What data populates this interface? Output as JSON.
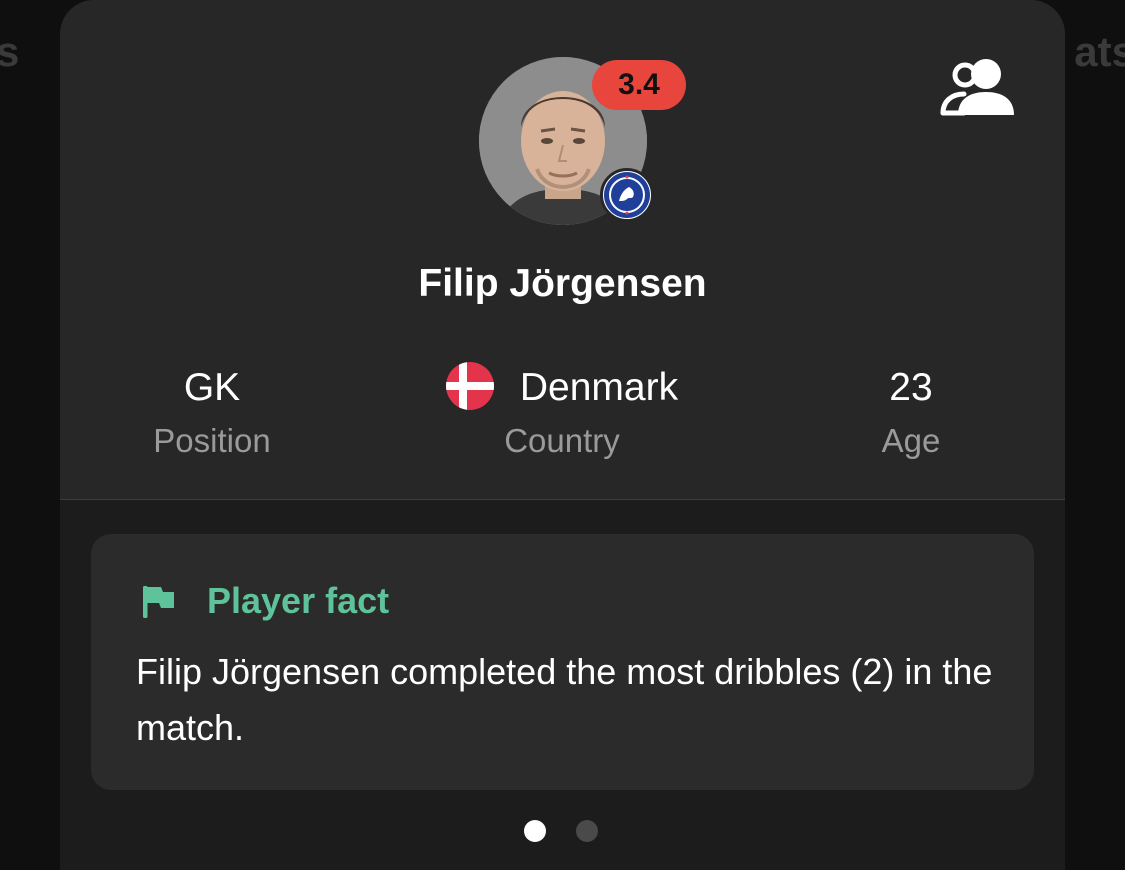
{
  "background": {
    "left_text": "s",
    "right_text": "ats"
  },
  "player": {
    "rating": "3.4",
    "name": "Filip Jörgensen",
    "photo_icon": "player-photo",
    "club_icon": "chelsea-badge-icon"
  },
  "info": {
    "position": {
      "value": "GK",
      "label": "Position"
    },
    "country": {
      "value": "Denmark",
      "label": "Country",
      "flag_icon": "denmark-flag-icon"
    },
    "age": {
      "value": "23",
      "label": "Age"
    }
  },
  "fact": {
    "title": "Player fact",
    "text": "Filip Jörgensen completed the most dribbles (2) in the match.",
    "icon": "flag-icon"
  },
  "pagination": {
    "count": 2,
    "active_index": 0
  },
  "colors": {
    "rating_bg": "#e8453c",
    "fact_accent": "#5ec39a",
    "sheet_bg": "#1c1c1c",
    "header_bg": "#272727"
  }
}
